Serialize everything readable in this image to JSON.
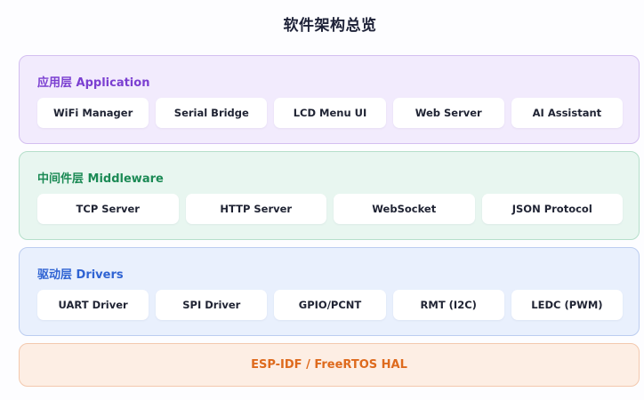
{
  "title": "软件架构总览",
  "layers": {
    "application": {
      "label": "应用层 Application",
      "modules": [
        "WiFi Manager",
        "Serial Bridge",
        "LCD Menu UI",
        "Web Server",
        "AI Assistant"
      ]
    },
    "middleware": {
      "label": "中间件层 Middleware",
      "modules": [
        "TCP Server",
        "HTTP Server",
        "WebSocket",
        "JSON Protocol"
      ]
    },
    "drivers": {
      "label": "驱动层 Drivers",
      "modules": [
        "UART Driver",
        "SPI Driver",
        "GPIO/PCNT",
        "RMT (I2C)",
        "LEDC (PWM)"
      ]
    },
    "hal": {
      "label": "ESP-IDF / FreeRTOS HAL"
    }
  },
  "colors": {
    "application": "#7b3fd1",
    "middleware": "#1b8a55",
    "drivers": "#2f63d3",
    "hal": "#de6a1d"
  }
}
